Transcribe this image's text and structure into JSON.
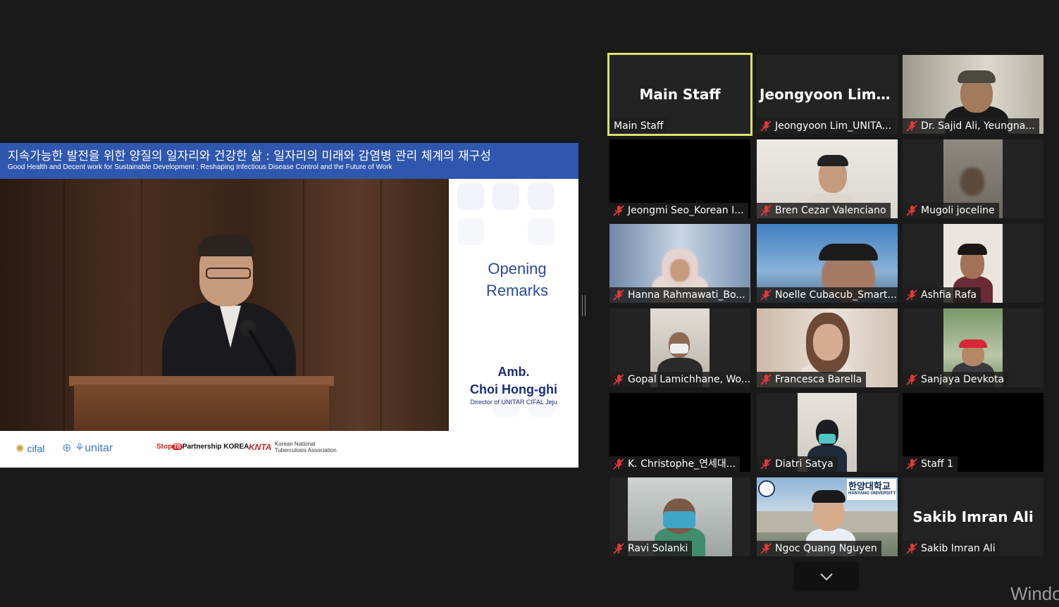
{
  "shared_screen": {
    "banner_korean": "지속가능한 발전을 위한 양질의 일자리와 건강한 삶 : 일자리의 미래와 감염병 관리 체계의 재구성",
    "banner_english": "Good Health and Decent work for Sustainable Development : Reshaping Infectious Disease Control and the Future of Work",
    "opening_line1": "Opening",
    "opening_line2": "Remarks",
    "speaker_title": "Amb.",
    "speaker_name": "Choi Hong-ghi",
    "speaker_role": "Director of UNITAR CIFAL Jeju",
    "logos": {
      "cifal": "cifal",
      "unitar": "unitar",
      "stoptb_prefix": "Stop",
      "stoptb_tb": "TB",
      "stoptb_suffix": "Partnership KOREA",
      "kntb_mark": "KNTA",
      "kntb_line1": "Korean National",
      "kntb_line2": "Tuberculosis Association"
    }
  },
  "gallery": {
    "tiles": [
      {
        "big": "Main Staff",
        "name": "Main Staff",
        "muted": false,
        "active": true
      },
      {
        "big": "Jeongyoon  Lim_...",
        "name": "Jeongyoon Lim_UNITA...",
        "muted": true
      },
      {
        "name": "Dr. Sajid Ali, Yeungna...",
        "muted": true
      },
      {
        "name": "Jeongmi Seo_Korean I...",
        "muted": true
      },
      {
        "name": "Bren Cezar Valenciano",
        "muted": true
      },
      {
        "name": "Mugoli joceline",
        "muted": true
      },
      {
        "name": "Hanna Rahmawati_Bo...",
        "muted": true
      },
      {
        "name": "Noelle Cubacub_Smart...",
        "muted": true
      },
      {
        "name": "Ashfia Rafa",
        "muted": true
      },
      {
        "name": "Gopal Lamichhane, Wo...",
        "muted": true
      },
      {
        "name": "Francesca Barella",
        "muted": true
      },
      {
        "name": "Sanjaya Devkota",
        "muted": true
      },
      {
        "name": "K. Christophe_연세대...",
        "muted": true
      },
      {
        "name": "Diatri Satya",
        "muted": true
      },
      {
        "name": "Staff 1",
        "muted": true
      },
      {
        "name": "Ravi Solanki",
        "muted": true
      },
      {
        "name": "Ngoc Quang Nguyen",
        "muted": true,
        "sign": "한양대학교",
        "sign_en": "HANYANG UNIVERSITY"
      },
      {
        "big": "Sakib Imran Ali",
        "name": "Sakib Imran Ali",
        "muted": true
      }
    ]
  },
  "controls": {
    "expand_icon": "chevron-down-icon"
  },
  "overlay": {
    "watermark": "Windo"
  },
  "colors": {
    "banner": "#2e57ad",
    "active_speaker": "#d8e36a",
    "mute_red": "#e0393b",
    "slide_text": "#2a4aa0"
  }
}
